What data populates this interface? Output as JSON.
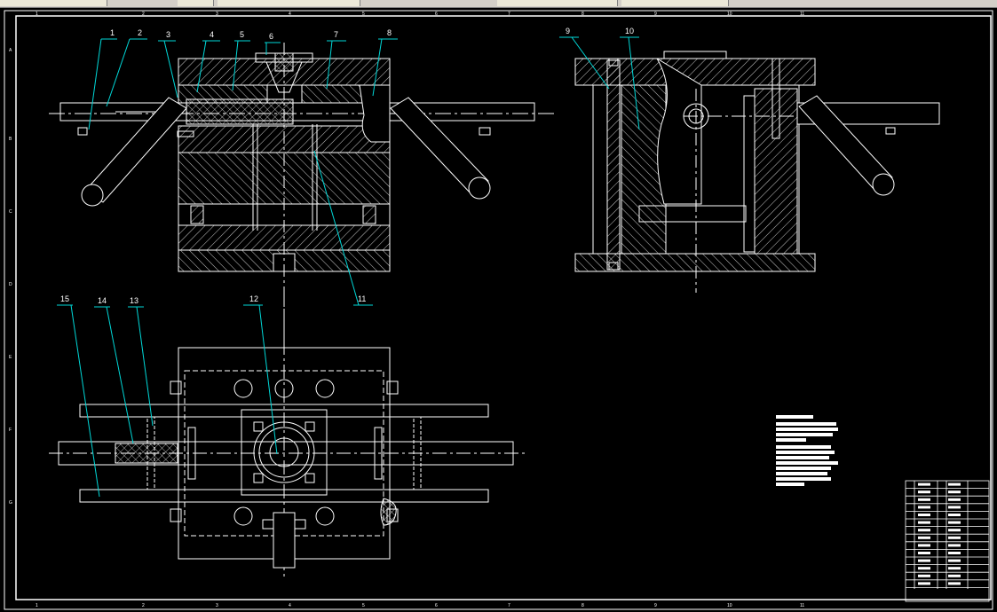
{
  "window": {
    "toolbar_hint": ""
  },
  "colors": {
    "background": "#000000",
    "line": "#ffffff",
    "leader": "#00d8d8",
    "hatch": "#ffffff",
    "centerline": "#ffffff"
  },
  "frame": {
    "column_labels": [
      "1",
      "2",
      "3",
      "4",
      "5",
      "6",
      "7",
      "8",
      "9",
      "10",
      "11"
    ],
    "row_labels": [
      "A",
      "B",
      "C",
      "D",
      "E",
      "F",
      "G"
    ]
  },
  "part_labels": [
    "1",
    "2",
    "3",
    "4",
    "5",
    "6",
    "7",
    "8",
    "9",
    "10",
    "11",
    "12",
    "13",
    "14",
    "15"
  ],
  "title_block": {
    "rows": 14,
    "caption": ""
  }
}
